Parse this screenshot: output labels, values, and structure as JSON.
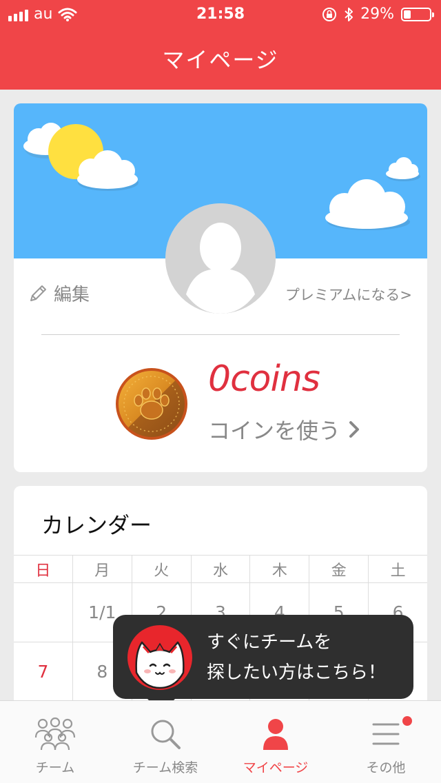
{
  "status_bar": {
    "carrier": "au",
    "time": "21:58",
    "battery_percent": "29%",
    "battery_level": 0.29
  },
  "header": {
    "title": "マイページ"
  },
  "profile": {
    "edit_label": "編集",
    "premium_label": "プレミアムになる>",
    "coins_text": "0coins",
    "use_coins_label": "コインを使う"
  },
  "calendar": {
    "title": "カレンダー",
    "weekdays": [
      "日",
      "月",
      "火",
      "水",
      "木",
      "金",
      "土"
    ],
    "weeks": [
      [
        "",
        "1/1",
        "2",
        "3",
        "4",
        "5",
        "6"
      ],
      [
        "7",
        "8",
        "",
        "",
        "",
        "",
        ""
      ]
    ]
  },
  "tooltip": {
    "line1": "すぐにチームを",
    "line2": "探したい方はこちら！"
  },
  "tabbar": {
    "items": [
      {
        "label": "チーム",
        "icon": "team-icon"
      },
      {
        "label": "チーム検索",
        "icon": "search-icon"
      },
      {
        "label": "マイページ",
        "icon": "person-icon"
      },
      {
        "label": "その他",
        "icon": "menu-icon"
      }
    ],
    "active_index": 2
  },
  "colors": {
    "brand_red": "#f04548",
    "sky_blue": "#56b6fb",
    "accent_red_text": "#e0303f"
  }
}
